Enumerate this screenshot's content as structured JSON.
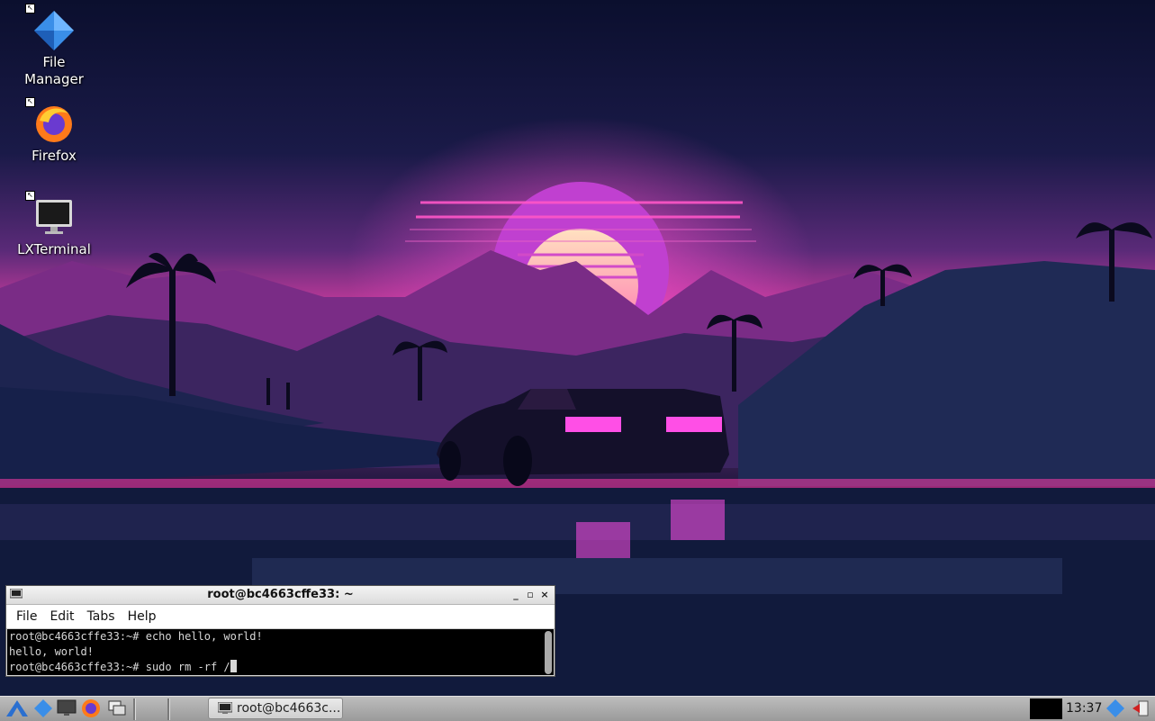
{
  "desktop": {
    "icons": [
      {
        "label": "File\nManager",
        "icon": "file-manager-icon"
      },
      {
        "label": "Firefox",
        "icon": "firefox-icon"
      },
      {
        "label": "LXTerminal",
        "icon": "terminal-monitor-icon"
      }
    ]
  },
  "terminal": {
    "title": "root@bc4663cffe33: ~",
    "controls": {
      "minimize": "_",
      "maximize": "▫",
      "close": "×"
    },
    "menu": [
      "File",
      "Edit",
      "Tabs",
      "Help"
    ],
    "lines": [
      "root@bc4663cffe33:~# echo hello, world!",
      "hello, world!",
      "root@bc4663cffe33:~# sudo rm -rf /"
    ]
  },
  "taskbar": {
    "launchers": [
      "start-menu-icon",
      "file-manager-icon",
      "desktop-icon",
      "firefox-icon",
      "window-switch-icon"
    ],
    "task_label": "root@bc4663c...",
    "clock": "13:37",
    "tray": [
      "network-icon",
      "logout-icon"
    ]
  },
  "colors": {
    "accent": "#e040d0",
    "sky_top": "#0d1030",
    "taskbar": "#a8a8a8"
  }
}
